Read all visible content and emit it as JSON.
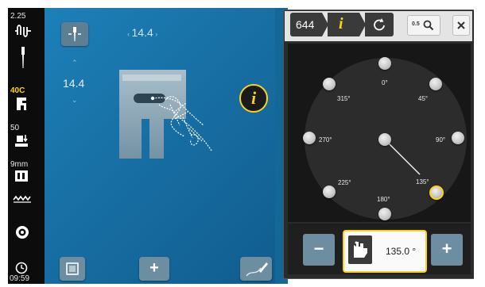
{
  "sidebar": {
    "top_value": "2.25",
    "presser_value": "40C",
    "tension_value": "50",
    "width_value": "9mm",
    "time": "09:59"
  },
  "stage": {
    "stitch_width_value": "14.4",
    "stitch_length_value": "14.4",
    "info_label": "i"
  },
  "panel": {
    "stitch_number": "644",
    "info_tab": "i",
    "zoom_label": "0.5",
    "angles": [
      "0°",
      "45°",
      "90°",
      "135°",
      "180°",
      "225°",
      "270°",
      "315°"
    ],
    "minus_label": "−",
    "plus_label": "+",
    "angle_value": "135.0 °"
  },
  "toolbar": {
    "add_label": "+"
  },
  "colors": {
    "accent": "#ffd21a",
    "stage_blue": "#1a78b0",
    "tile": "#6d8ea1"
  }
}
